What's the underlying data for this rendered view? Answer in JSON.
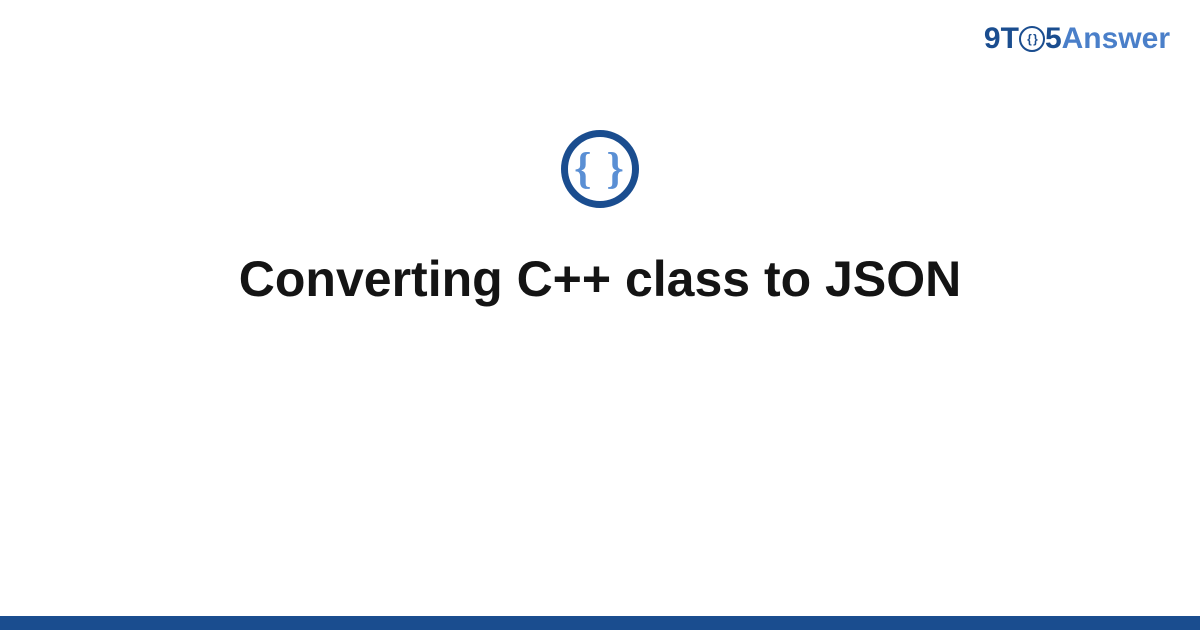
{
  "brand": {
    "part1": "9T",
    "circle_inner": "{ }",
    "part2": "5",
    "part3": "Answer"
  },
  "icon": {
    "braces": "{ }"
  },
  "page_title": "Converting C++ class to JSON",
  "colors": {
    "brand_primary": "#1a4d8f",
    "brand_secondary": "#4a7fc9",
    "icon_braces": "#5a8fd4"
  }
}
